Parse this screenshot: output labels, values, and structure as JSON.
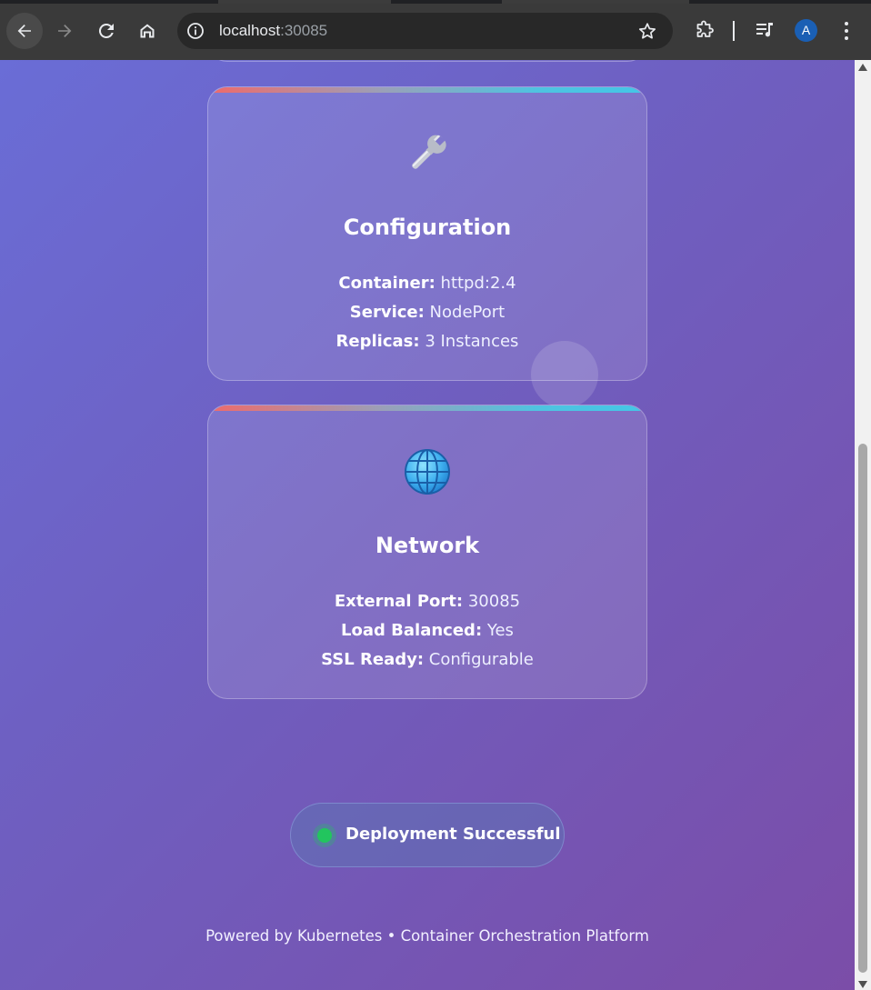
{
  "browser": {
    "url_host": "localhost",
    "url_port": ":30085",
    "profile_initial": "A"
  },
  "icons": {
    "back": "arrow-left-icon",
    "forward": "arrow-right-icon",
    "reload": "reload-icon",
    "home": "home-icon",
    "site_info": "info-icon",
    "bookmark": "star-icon",
    "extensions": "puzzle-icon",
    "media": "media-queue-icon",
    "menu": "kebab-menu-icon",
    "config_card": "wrench-icon",
    "network_card": "globe-icon"
  },
  "cards": {
    "configuration": {
      "title": "Configuration",
      "rows": [
        {
          "key": "Container:",
          "value": "httpd:2.4"
        },
        {
          "key": "Service:",
          "value": "NodePort"
        },
        {
          "key": "Replicas:",
          "value": "3 Instances"
        }
      ]
    },
    "network": {
      "title": "Network",
      "rows": [
        {
          "key": "External Port:",
          "value": "30085"
        },
        {
          "key": "Load Balanced:",
          "value": "Yes"
        },
        {
          "key": "SSL Ready:",
          "value": "Configurable"
        }
      ]
    }
  },
  "status": {
    "label": "Deployment Successful",
    "color": "#22c55e"
  },
  "footer": {
    "text": "Powered by Kubernetes • Container Orchestration Platform"
  },
  "colors": {
    "background_start": "#6a6dd6",
    "background_end": "#7b4da8",
    "accent_red": "#ef6a6a",
    "accent_cyan": "#44c6e6"
  }
}
